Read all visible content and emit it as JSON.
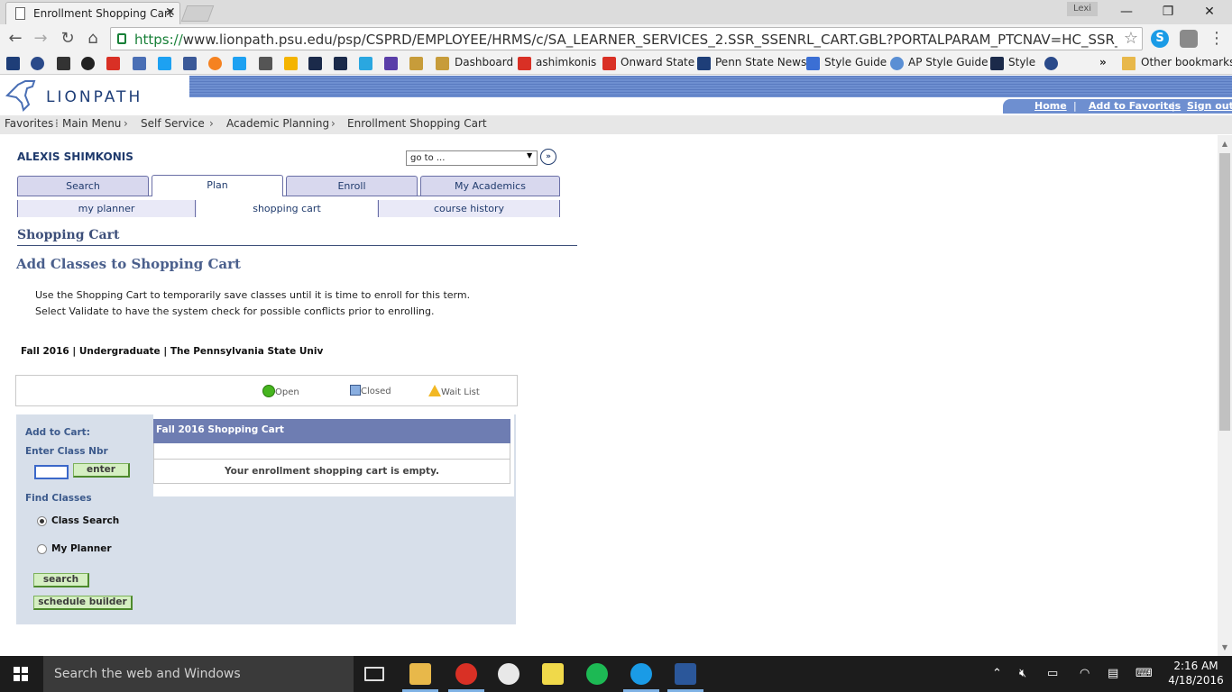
{
  "browser": {
    "tab_title": "Enrollment Shopping Cart",
    "tab_close": "✕",
    "user_badge": "Lexi",
    "url_protocol": "https://",
    "url_rest": "www.lionpath.psu.edu/psp/CSPRD/EMPLOYEE/HRMS/c/SA_LEARNER_SERVICES_2.SSR_SSENRL_CART.GBL?PORTALPARAM_PTCNAV=HC_SSR_SSENRL",
    "bookmarks": [
      "Dashboard",
      "ashimkonis",
      "Onward State",
      "Penn State News",
      "Style Guide",
      "AP Style Guide",
      "Style"
    ],
    "bookmarks_overflow": "»",
    "other_bookmarks": "Other bookmarks"
  },
  "header": {
    "logo_text": "LIONPATH",
    "links": [
      "Home",
      "Add to Favorites",
      "Sign out"
    ]
  },
  "breadcrumb": [
    "Favorites",
    "Main Menu",
    "Self Service",
    "Academic Planning",
    "Enrollment Shopping Cart"
  ],
  "page": {
    "student_name": "ALEXIS SHIMKONIS",
    "goto_value": "go to ...",
    "main_tabs": [
      "Search",
      "Plan",
      "Enroll",
      "My Academics"
    ],
    "sub_tabs": [
      "my planner",
      "shopping cart",
      "course history"
    ],
    "title": "Shopping Cart",
    "subtitle": "Add Classes to Shopping Cart",
    "instructions": [
      "Use the Shopping Cart to temporarily save classes until it is time to enroll for this term.",
      "Select Validate to have the system check for possible conflicts prior to enrolling."
    ],
    "term_line": "Fall 2016 | Undergraduate | The Pennsylvania State Univ",
    "legend": [
      "Open",
      "Closed",
      "Wait List"
    ],
    "cart": {
      "add_to_cart": "Add to Cart:",
      "enter_class_nbr": "Enter Class Nbr",
      "enter_button": "enter",
      "find_classes": "Find Classes",
      "option_class_search": "Class Search",
      "option_my_planner": "My Planner",
      "search_button": "search",
      "schedule_builder_button": "schedule builder",
      "panel_title": "Fall 2016 Shopping Cart",
      "empty_message": "Your enrollment shopping cart is empty."
    }
  },
  "taskbar": {
    "search_placeholder": "Search the web and Windows",
    "time": "2:16 AM",
    "date": "4/18/2016"
  }
}
